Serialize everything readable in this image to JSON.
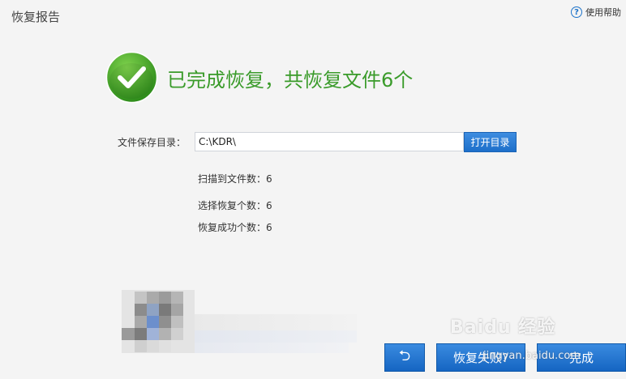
{
  "window": {
    "title": "恢复报告"
  },
  "help": {
    "icon_glyph": "?",
    "label": "使用帮助"
  },
  "result": {
    "headline": "已完成恢复，共恢复文件6个",
    "icon": "checkmark-circle-icon",
    "color": "#3a9b2a"
  },
  "save_dir": {
    "label": "文件保存目录：",
    "value": "C:\\KDR\\",
    "open_button": "打开目录"
  },
  "stats": {
    "scanned": "扫描到文件数：6",
    "selected": "选择恢复个数：6",
    "recovered": "恢复成功个数：6"
  },
  "footer": {
    "back_icon": "undo-arrow-icon",
    "back_glyph": "⮌",
    "recover_again_label": "恢复失败?",
    "finish_label": "完成"
  },
  "watermark": {
    "brand": "Baidu 经验",
    "url": "jingyan.baidu.com"
  },
  "colors": {
    "accent": "#1d6fca",
    "success": "#3a9b2a",
    "background": "#f4f4f4"
  }
}
